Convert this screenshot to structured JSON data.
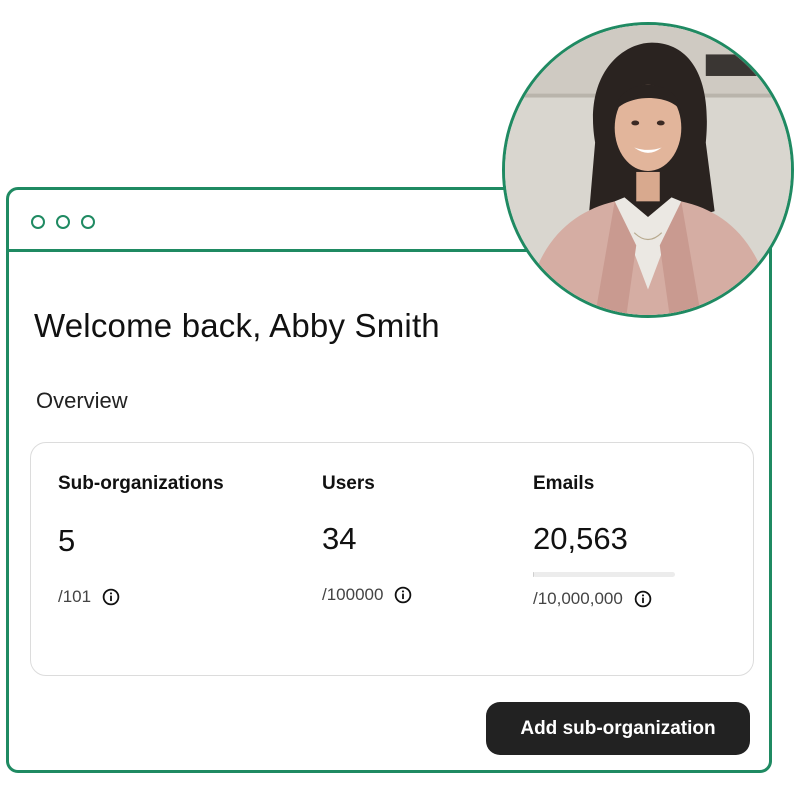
{
  "greeting": "Welcome back, Abby Smith",
  "section_title": "Overview",
  "stats": [
    {
      "label": "Sub-organizations",
      "value": "5",
      "limit": "/101"
    },
    {
      "label": "Users",
      "value": "34",
      "limit": "/100000"
    },
    {
      "label": "Emails",
      "value": "20,563",
      "limit": "/10,000,000",
      "progress": 0.002
    }
  ],
  "primary_action": "Add sub-organization",
  "colors": {
    "accent": "#1f8a62",
    "button_bg": "#222222",
    "card_border": "#dcdcdc"
  },
  "icons": {
    "window_controls": [
      "window-dot-icon",
      "window-dot-icon",
      "window-dot-icon"
    ],
    "info": "info-circle-icon"
  }
}
